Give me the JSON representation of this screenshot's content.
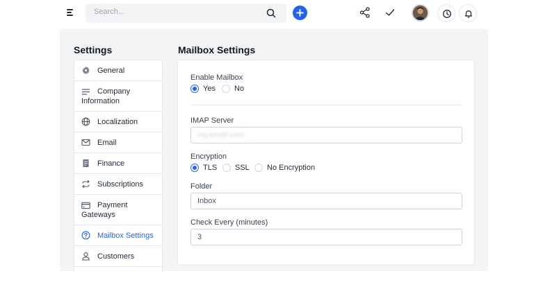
{
  "header": {
    "search_placeholder": "Search..."
  },
  "sidebar": {
    "title": "Settings",
    "items": [
      {
        "label": "General",
        "icon": "gear-icon"
      },
      {
        "label": "Company",
        "label2": "Information",
        "icon": "lines-icon"
      },
      {
        "label": "Localization",
        "icon": "globe-icon"
      },
      {
        "label": "Email",
        "icon": "mail-icon"
      },
      {
        "label": "Finance",
        "icon": "document-icon"
      },
      {
        "label": "Subscriptions",
        "icon": "repeat-icon"
      },
      {
        "label": "Payment",
        "label2": "Gateways",
        "icon": "card-icon"
      },
      {
        "label": "Mailbox Settings",
        "icon": "question-circle-icon",
        "active": true
      },
      {
        "label": "Customers",
        "icon": "user-icon"
      }
    ]
  },
  "panel": {
    "title": "Mailbox Settings",
    "enable_mailbox": {
      "label": "Enable Mailbox",
      "options": [
        "Yes",
        "No"
      ],
      "selected": "Yes"
    },
    "imap_server": {
      "label": "IMAP Server",
      "value": "my.email.com"
    },
    "encryption": {
      "label": "Encryption",
      "options": [
        "TLS",
        "SSL",
        "No Encryption"
      ],
      "selected": "TLS"
    },
    "folder": {
      "label": "Folder",
      "value": "Inbox"
    },
    "check_every": {
      "label": "Check Every (minutes)",
      "value": "3"
    }
  },
  "colors": {
    "accent": "#2563eb",
    "background": "#f3f4f6"
  }
}
